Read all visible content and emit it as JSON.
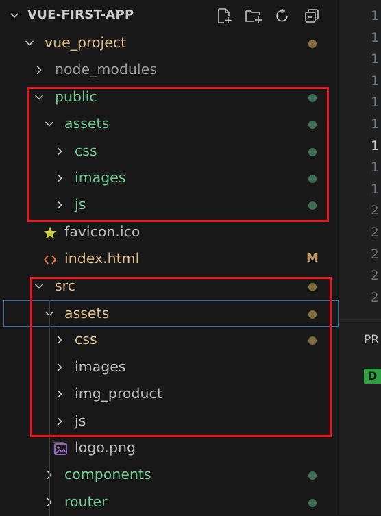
{
  "explorer": {
    "title": "VUE-FIRST-APP",
    "actions": [
      "new-file-icon",
      "new-folder-icon",
      "refresh-icon",
      "collapse-all-icon"
    ]
  },
  "colors": {
    "git_modified": "#e2c08d",
    "git_untracked": "#73c991",
    "modified_dot": "#7d6b3c",
    "untracked_dot": "#3e6b52",
    "default_text": "#bcbcbc",
    "dim_text": "#999999",
    "highlight_box": "#e8141f",
    "focus_border": "#2f6fba"
  },
  "tree": [
    {
      "label": "vue_project",
      "depth": 1,
      "type": "folder",
      "expanded": true,
      "status": "modified",
      "decoration": "dot"
    },
    {
      "label": "node_modules",
      "depth": 2,
      "type": "folder",
      "expanded": false,
      "status": "ignored",
      "decoration": "none"
    },
    {
      "label": "public",
      "depth": 2,
      "type": "folder",
      "expanded": true,
      "status": "untracked",
      "decoration": "dot"
    },
    {
      "label": "assets",
      "depth": 3,
      "type": "folder",
      "expanded": true,
      "status": "untracked",
      "decoration": "dot"
    },
    {
      "label": "css",
      "depth": 4,
      "type": "folder",
      "expanded": false,
      "status": "untracked",
      "decoration": "dot"
    },
    {
      "label": "images",
      "depth": 4,
      "type": "folder",
      "expanded": false,
      "status": "untracked",
      "decoration": "dot"
    },
    {
      "label": "js",
      "depth": 4,
      "type": "folder",
      "expanded": false,
      "status": "untracked",
      "decoration": "dot"
    },
    {
      "label": "favicon.ico",
      "depth": 3,
      "type": "file",
      "icon": "star-icon",
      "status": "default",
      "decoration": "none"
    },
    {
      "label": "index.html",
      "depth": 3,
      "type": "file",
      "icon": "html-code-icon",
      "status": "modified",
      "decoration": "M"
    },
    {
      "label": "src",
      "depth": 2,
      "type": "folder",
      "expanded": true,
      "status": "modified",
      "decoration": "dot"
    },
    {
      "label": "assets",
      "depth": 3,
      "type": "folder",
      "expanded": true,
      "status": "modified",
      "decoration": "dot",
      "focused": true
    },
    {
      "label": "css",
      "depth": 4,
      "type": "folder",
      "expanded": false,
      "status": "modified",
      "decoration": "dot"
    },
    {
      "label": "images",
      "depth": 4,
      "type": "folder",
      "expanded": false,
      "status": "default",
      "decoration": "none"
    },
    {
      "label": "img_product",
      "depth": 4,
      "type": "folder",
      "expanded": false,
      "status": "default",
      "decoration": "none"
    },
    {
      "label": "js",
      "depth": 4,
      "type": "folder",
      "expanded": false,
      "status": "default",
      "decoration": "none"
    },
    {
      "label": "logo.png",
      "depth": 4,
      "type": "file",
      "icon": "image-file-icon",
      "status": "default",
      "decoration": "none"
    },
    {
      "label": "components",
      "depth": 3,
      "type": "folder",
      "expanded": false,
      "status": "untracked",
      "decoration": "dot"
    },
    {
      "label": "router",
      "depth": 3,
      "type": "folder",
      "expanded": false,
      "status": "untracked",
      "decoration": "dot"
    }
  ],
  "editor": {
    "line_numbers": [
      "1",
      "1",
      "1",
      "1",
      "1",
      "1",
      "1",
      "1",
      "1",
      "2",
      "2",
      "2",
      "2",
      "2"
    ],
    "active_line_index": 6
  },
  "panel": {
    "title": "PR",
    "badge": "D"
  }
}
